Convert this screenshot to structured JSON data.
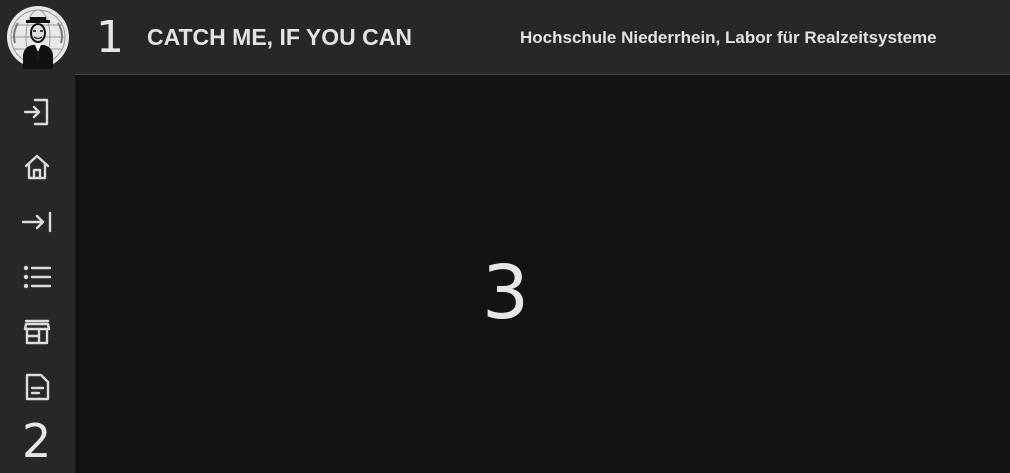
{
  "header": {
    "region_number": "1",
    "app_title": "CATCH ME, IF YOU CAN",
    "organization": "Hochschule Niederrhein, Labor für Realzeitsysteme",
    "logo_icon": "anonymous-mask-logo"
  },
  "sidebar": {
    "region_number": "2",
    "items": [
      {
        "icon": "login-icon"
      },
      {
        "icon": "home-icon"
      },
      {
        "icon": "arrow-right-to-bar-icon"
      },
      {
        "icon": "list-icon"
      },
      {
        "icon": "store-icon"
      },
      {
        "icon": "document-icon"
      }
    ]
  },
  "main": {
    "region_number": "3"
  },
  "colors": {
    "bar_background": "#272727",
    "content_background": "#131313",
    "text": "#e6e6e6"
  }
}
